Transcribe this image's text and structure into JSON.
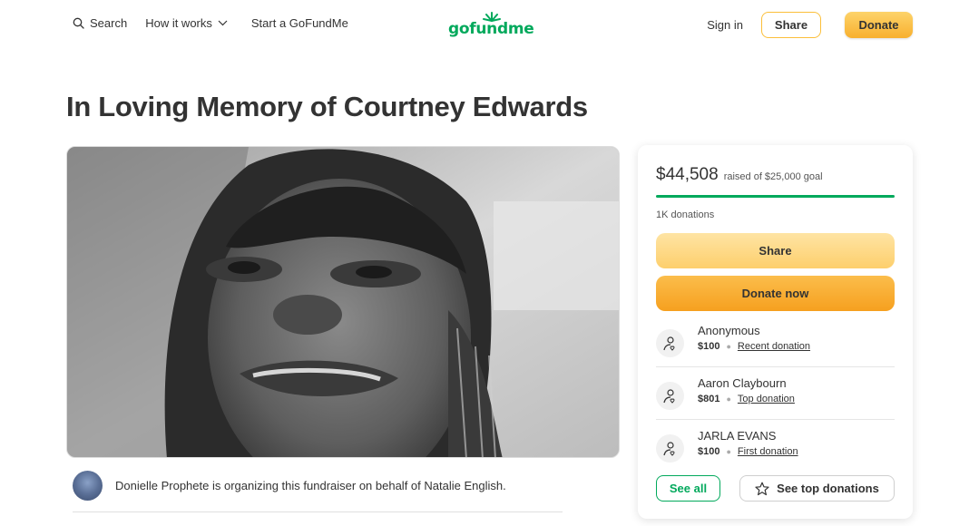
{
  "header": {
    "search_label": "Search",
    "how_it_works_label": "How it works",
    "start_label": "Start a GoFundMe",
    "logo_text": "gofundme",
    "signin_label": "Sign in",
    "share_label": "Share",
    "donate_label": "Donate"
  },
  "campaign": {
    "title": "In Loving Memory of Courtney Edwards",
    "organizer_text": "Donielle Prophete is organizing this fundraiser on behalf of Natalie English."
  },
  "sidebar": {
    "raised_amount": "$44,508",
    "goal_text": "raised of $25,000 goal",
    "progress_fraction": 1.0,
    "donation_count": "1K donations",
    "share_label": "Share",
    "donate_now_label": "Donate now",
    "donations": [
      {
        "name": "Anonymous",
        "amount": "$100",
        "tag": "Recent donation"
      },
      {
        "name": "Aaron Claybourn",
        "amount": "$801",
        "tag": "Top donation"
      },
      {
        "name": "JARLA EVANS",
        "amount": "$100",
        "tag": "First donation"
      }
    ],
    "see_all_label": "See all",
    "see_top_label": "See top donations"
  },
  "colors": {
    "brand_green": "#02a95c",
    "donate_yellow": "#f8b02e",
    "share_yellow": "#fdcf6c"
  },
  "icons": {
    "search": "search-icon",
    "chevron": "chevron-down-icon",
    "donor": "donor-heart-icon",
    "star": "star-icon"
  }
}
